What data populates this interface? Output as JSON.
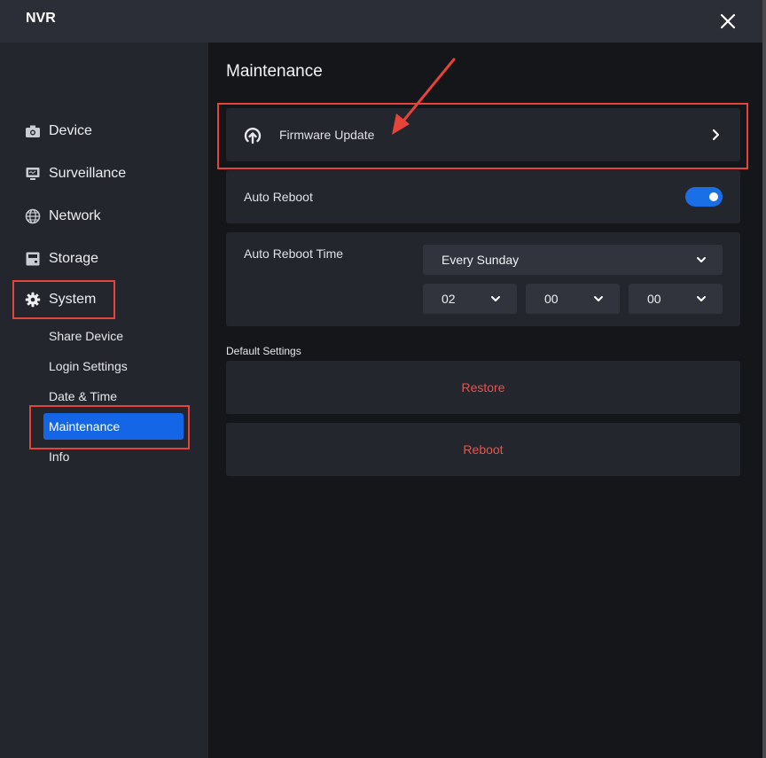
{
  "app": {
    "title": "NVR"
  },
  "sidebar": {
    "items": [
      {
        "label": "Device",
        "icon": "camera-icon"
      },
      {
        "label": "Surveillance",
        "icon": "monitor-icon"
      },
      {
        "label": "Network",
        "icon": "globe-icon"
      },
      {
        "label": "Storage",
        "icon": "storage-icon"
      },
      {
        "label": "System",
        "icon": "gear-icon"
      }
    ],
    "sub_items": [
      {
        "label": "Share Device"
      },
      {
        "label": "Login Settings"
      },
      {
        "label": "Date & Time"
      },
      {
        "label": "Maintenance",
        "active": true
      },
      {
        "label": "Info"
      }
    ]
  },
  "main": {
    "title": "Maintenance",
    "firmware": {
      "label": "Firmware Update",
      "icon": "upload-cloud-icon"
    },
    "auto_reboot": {
      "label": "Auto Reboot",
      "enabled": true
    },
    "auto_reboot_time": {
      "label": "Auto Reboot Time",
      "day": "Every Sunday",
      "hour": "02",
      "minute": "00",
      "second": "00"
    },
    "default_settings": {
      "label": "Default Settings",
      "restore_label": "Restore",
      "reboot_label": "Reboot"
    }
  },
  "colors": {
    "accent": "#1466e6",
    "highlight": "#e5443b",
    "danger_text": "#e8534d"
  }
}
